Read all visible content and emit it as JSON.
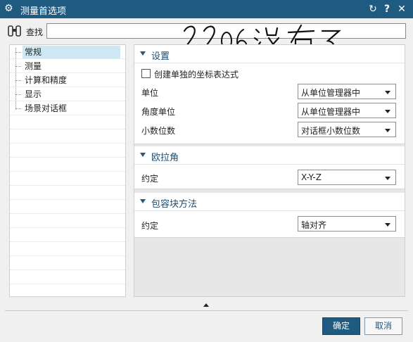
{
  "window": {
    "title": "测量首选项",
    "icons": {
      "app": "gear-icon",
      "reset": "reset-icon",
      "help": "help-icon",
      "close": "close-icon"
    },
    "help_glyph": "?",
    "close_glyph": "✕",
    "reset_glyph": "↻"
  },
  "find": {
    "label": "查找",
    "value": "",
    "icon": "binoculars-icon"
  },
  "handwriting": "2206没有了",
  "tree": {
    "items": [
      "常规",
      "测量",
      "计算和精度",
      "显示",
      "场景对话框"
    ],
    "selected_index": 0
  },
  "sections": {
    "settings": {
      "title": "设置",
      "checkbox_label": "创建单独的坐标表达式",
      "checkbox_checked": false,
      "rows": [
        {
          "label": "单位",
          "value": "从单位管理器中"
        },
        {
          "label": "角度单位",
          "value": "从单位管理器中"
        },
        {
          "label": "小数位数",
          "value": "对话框小数位数"
        }
      ]
    },
    "euler": {
      "title": "欧拉角",
      "rows": [
        {
          "label": "约定",
          "value": "X-Y-Z"
        }
      ]
    },
    "bbox": {
      "title": "包容块方法",
      "rows": [
        {
          "label": "约定",
          "value": "轴对齐"
        }
      ]
    }
  },
  "buttons": {
    "ok": "确定",
    "cancel": "取消"
  },
  "colors": {
    "titlebar": "#1f5a80",
    "accent": "#1a4d72",
    "selected": "#cde8f3"
  }
}
